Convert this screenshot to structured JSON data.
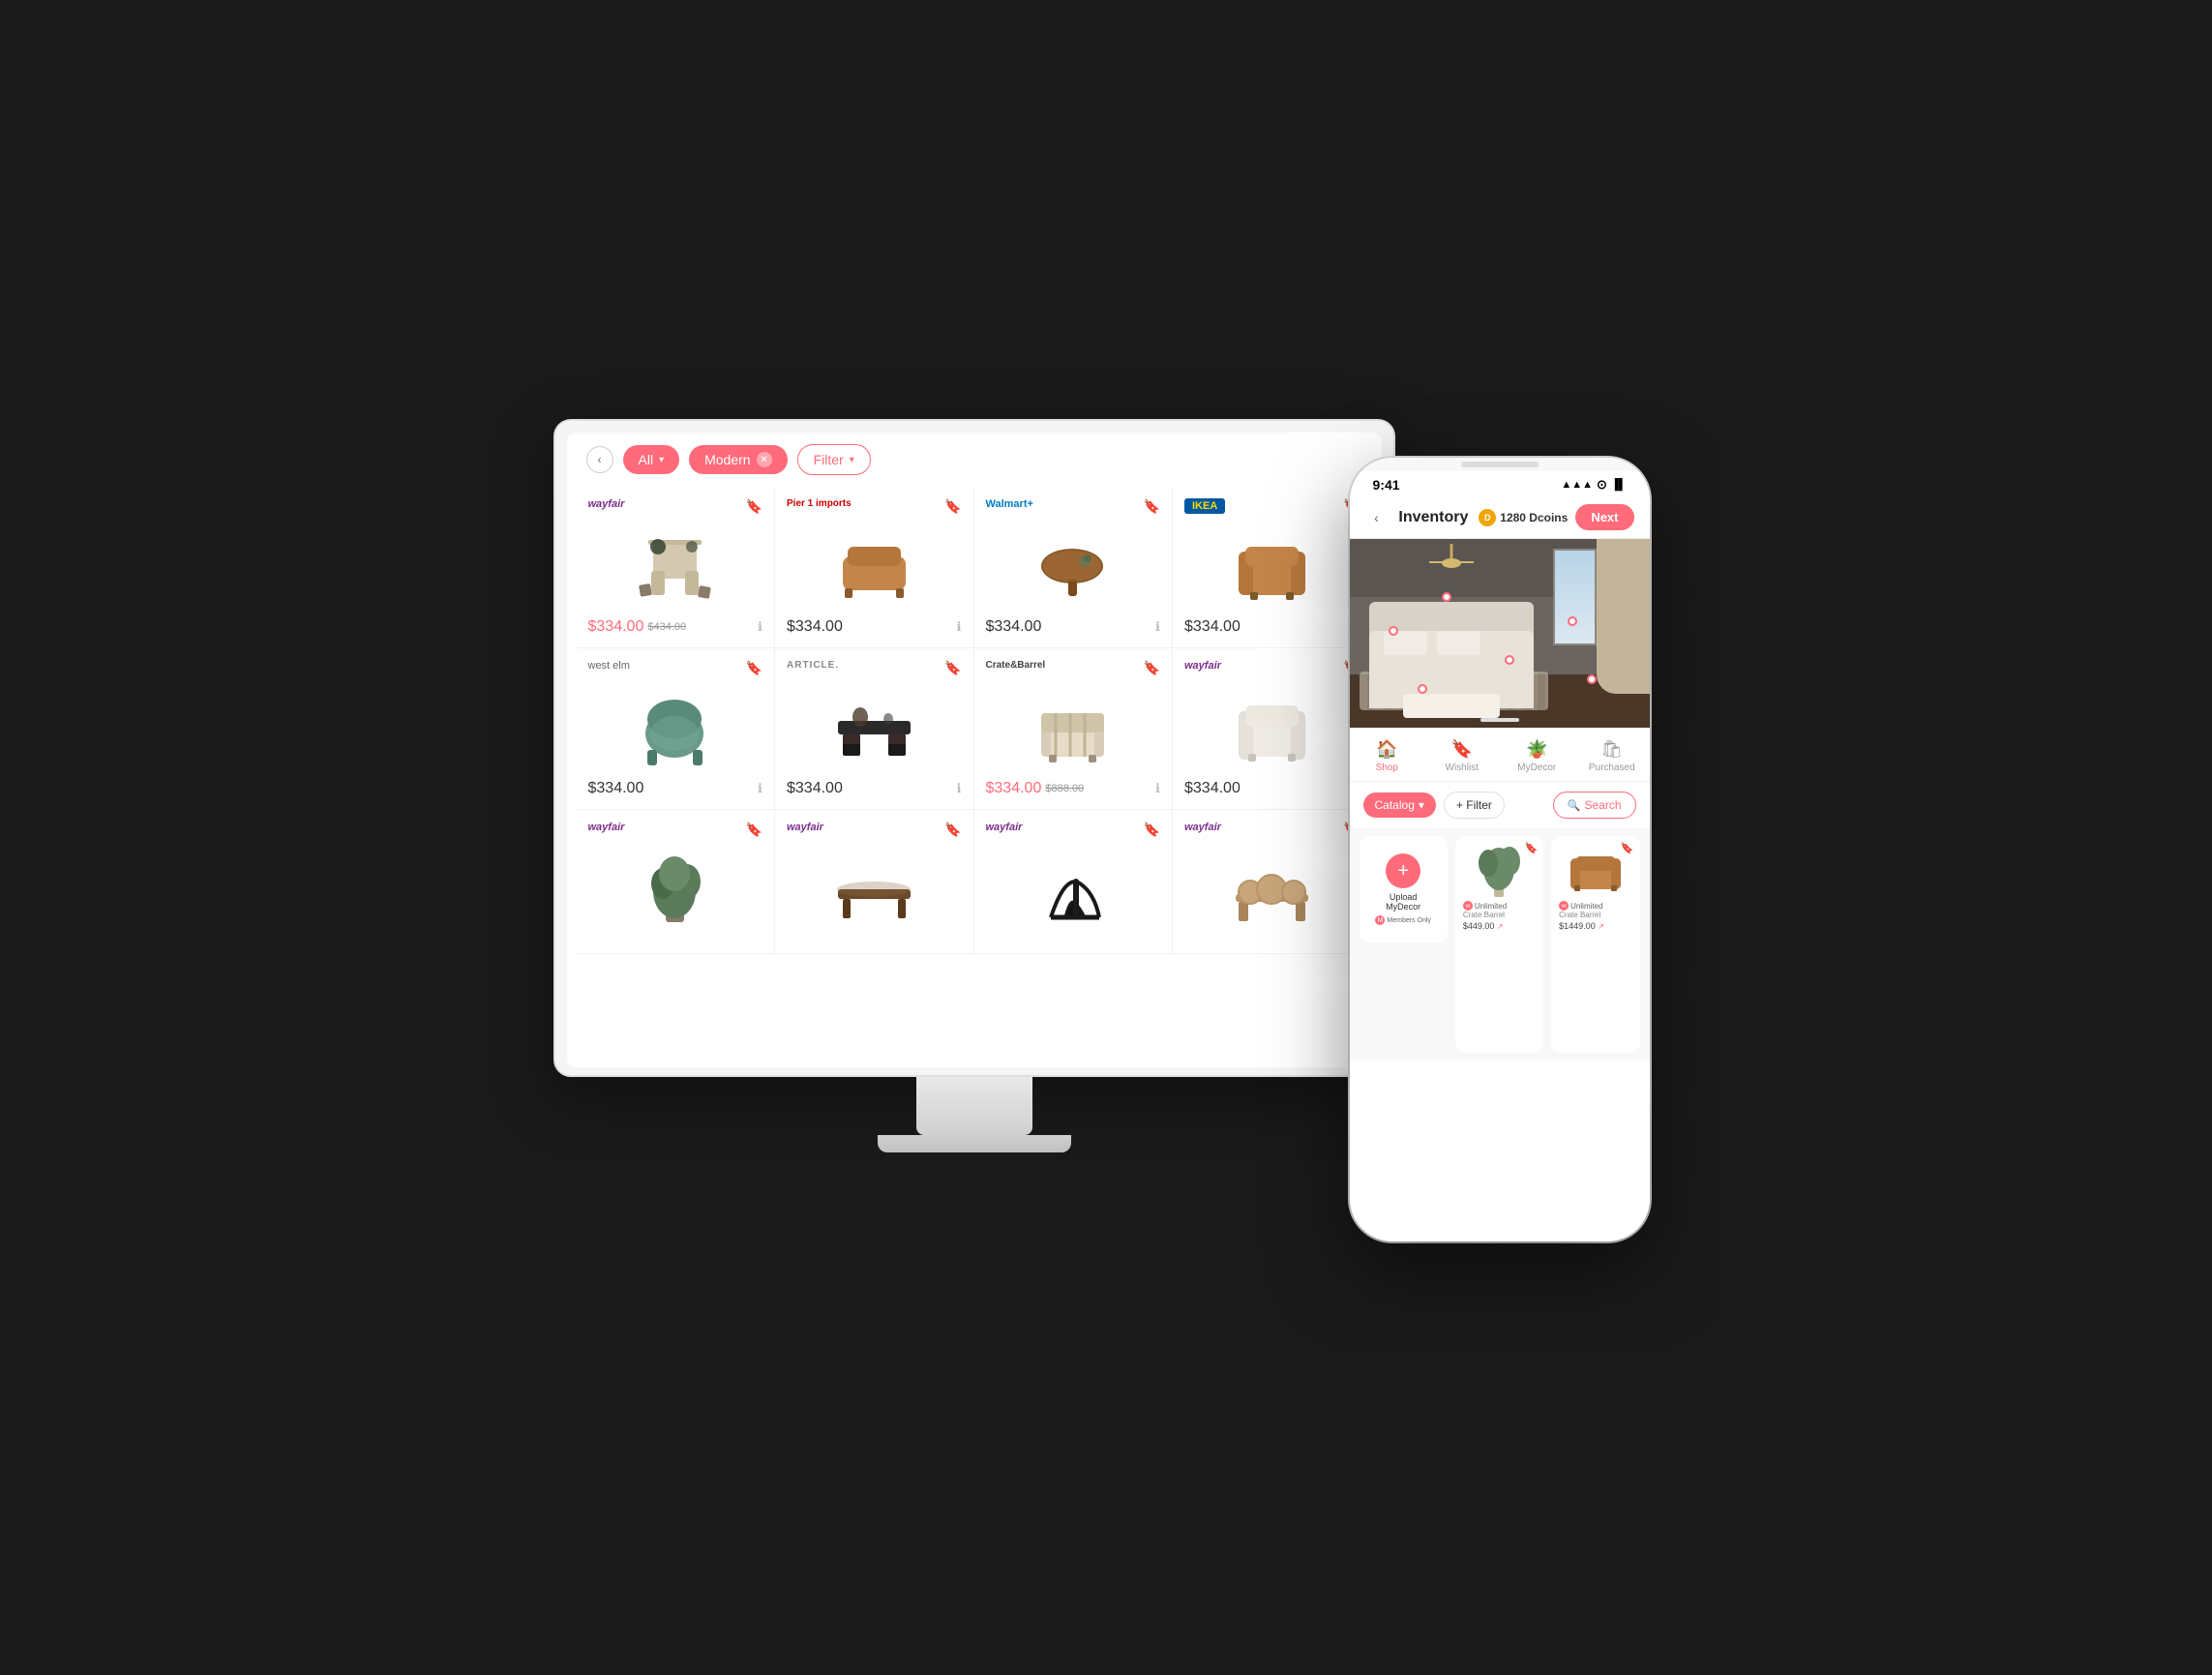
{
  "desktop": {
    "back_label": "‹",
    "filters": {
      "all_label": "All",
      "modern_label": "Modern",
      "filter_label": "Filter"
    },
    "products": [
      {
        "brand": "wayfair",
        "brand_class": "brand-wayfair",
        "price_sale": "$334.00",
        "price_original": "$434.00",
        "is_sale": true,
        "shape": "dining-set"
      },
      {
        "brand": "Pier 1 imports",
        "brand_class": "brand-pier1",
        "price_sale": null,
        "price_original": null,
        "price_current": "$334.00",
        "shape": "ottoman-brown"
      },
      {
        "brand": "Walmart+",
        "brand_class": "brand-walmart",
        "price_current": "$334.00",
        "shape": "round-table"
      },
      {
        "brand": "IKEA",
        "brand_class": "brand-ikea",
        "price_current": "$334.00",
        "shape": "armchair-leather"
      },
      {
        "brand": "west elm",
        "brand_class": "brand-westelm",
        "price_current": "$334.00",
        "shape": "velvet-chair"
      },
      {
        "brand": "ARTICLE.",
        "brand_class": "brand-article",
        "price_current": "$334.00",
        "shape": "console-table"
      },
      {
        "brand": "Crate&Barrel",
        "brand_class": "brand-cratebarrel",
        "price_sale": "$334.00",
        "price_original": "$888.00",
        "is_sale": true,
        "shape": "striped-chair"
      },
      {
        "brand": "wayfair",
        "brand_class": "brand-wayfair",
        "price_current": "$334.00",
        "shape": "white-armchair"
      },
      {
        "brand": "wayfair",
        "brand_class": "brand-wayfair",
        "price_current": "",
        "shape": "plant"
      },
      {
        "brand": "wayfair",
        "brand_class": "brand-wayfair",
        "price_current": "",
        "shape": "coffee-table"
      },
      {
        "brand": "wayfair",
        "brand_class": "brand-wayfair",
        "price_current": "",
        "shape": "black-chair"
      },
      {
        "brand": "wayfair",
        "brand_class": "brand-wayfair",
        "price_current": "",
        "shape": "rattan-set"
      }
    ]
  },
  "phone": {
    "status_bar": {
      "time": "9:41",
      "icons": "▲ WiFi Battery"
    },
    "nav": {
      "back_label": "‹",
      "title": "Inventory",
      "dcoins": "1280 Dcoins",
      "next_label": "Next"
    },
    "tabs": [
      {
        "icon": "🏠",
        "label": "Shop",
        "active": true
      },
      {
        "icon": "🔖",
        "label": "Wishlist",
        "active": false
      },
      {
        "icon": "🪴",
        "label": "MyDecor",
        "active": false
      },
      {
        "icon": "🛍",
        "label": "Purchased",
        "active": false
      }
    ],
    "filter_bar": {
      "catalog_label": "Catalog",
      "add_filter_label": "+ Filter",
      "search_label": "Search"
    },
    "products": [
      {
        "type": "upload",
        "label": "Upload\nMyDecor",
        "members_badge": "Members Only"
      },
      {
        "type": "item",
        "brand": "Crate Barrel",
        "price": "$449.00",
        "badge": "Unlimited",
        "shape": "plant-tall"
      },
      {
        "type": "item",
        "brand": "Crate Barrel",
        "price": "$1449.00",
        "badge": "Unlimited",
        "shape": "sofa-cognac"
      }
    ]
  }
}
